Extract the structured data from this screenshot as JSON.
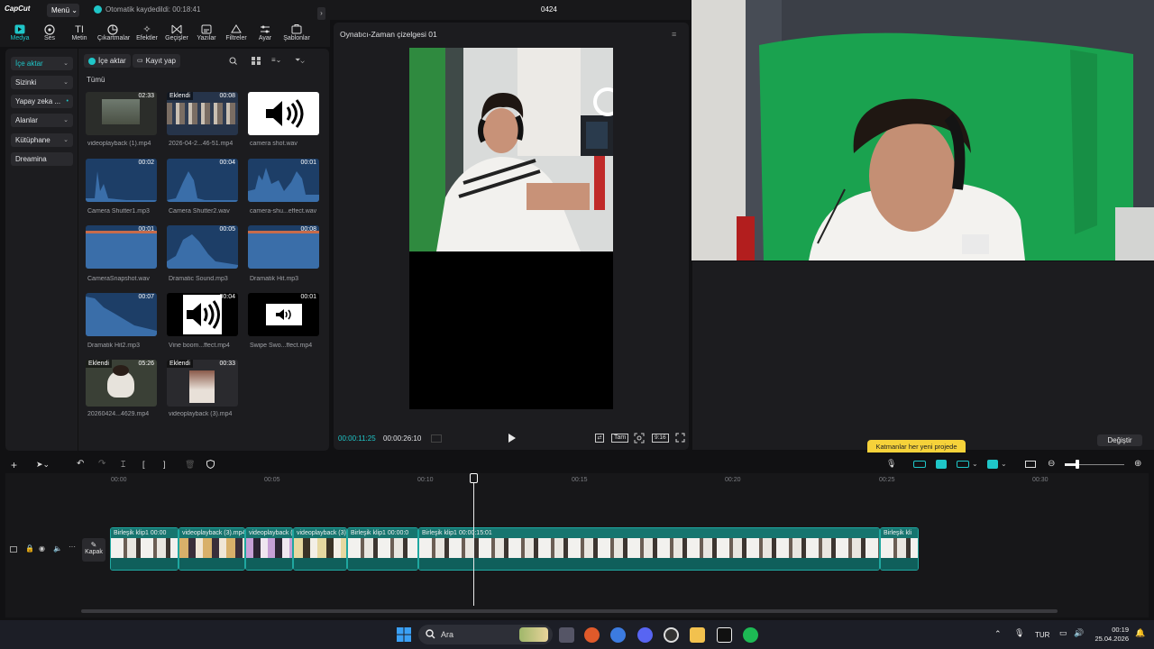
{
  "app": {
    "logo": "CapCut",
    "menu_label": "Menü",
    "save_status": "Otomatik kaydedildi: 00:18:41",
    "project_name": "0424"
  },
  "toolbar": {
    "tabs": [
      {
        "label": "Medya",
        "icon": "media-icon"
      },
      {
        "label": "Ses",
        "icon": "audio-icon"
      },
      {
        "label": "Metin",
        "icon": "text-icon"
      },
      {
        "label": "Çıkartmalar",
        "icon": "sticker-icon"
      },
      {
        "label": "Efektler",
        "icon": "effects-icon"
      },
      {
        "label": "Geçişler",
        "icon": "transitions-icon"
      },
      {
        "label": "Yazılar",
        "icon": "captions-icon"
      },
      {
        "label": "Filtreler",
        "icon": "filters-icon"
      },
      {
        "label": "Ayar",
        "icon": "adjust-icon"
      },
      {
        "label": "Şablonlar",
        "icon": "templates-icon"
      }
    ]
  },
  "sidebar": {
    "items": [
      {
        "label": "İçe aktar"
      },
      {
        "label": "Sizinki"
      },
      {
        "label": "Yapay zeka ..."
      },
      {
        "label": "Alanlar"
      },
      {
        "label": "Kütüphane"
      },
      {
        "label": "Dreamina"
      }
    ]
  },
  "media": {
    "import_label": "İçe aktar",
    "record_label": "Kayıt yap",
    "filter_all": "Tümü",
    "added_badge": "Eklendi",
    "items": [
      {
        "name": "videoplayback (1).mp4",
        "duration": "02:33"
      },
      {
        "name": "2026-04-2...46-51.mp4",
        "duration": "00:08"
      },
      {
        "name": "camera shot.wav",
        "duration": ""
      },
      {
        "name": "Camera Shutter1.mp3",
        "duration": "00:02"
      },
      {
        "name": "Camera Shutter2.wav",
        "duration": "00:04"
      },
      {
        "name": "camera-shu...effect.wav",
        "duration": "00:01"
      },
      {
        "name": "CameraSnapshot.wav",
        "duration": "00:01"
      },
      {
        "name": "Dramatic Sound.mp3",
        "duration": "00:05"
      },
      {
        "name": "Dramatik Hit.mp3",
        "duration": "00:08"
      },
      {
        "name": "Dramatik Hit2.mp3",
        "duration": "00:07"
      },
      {
        "name": "Vine boom...ffect.mp4",
        "duration": "00:04"
      },
      {
        "name": "Swipe Swo...ffect.mp4",
        "duration": "00:01"
      },
      {
        "name": "20260424...4629.mp4",
        "duration": "05:26"
      },
      {
        "name": "videoplayback (3).mp4",
        "duration": "00:33"
      }
    ]
  },
  "player": {
    "title": "Oynatıcı-Zaman çizelgesi 01",
    "current_time": "00:00:11:25",
    "total_time": "00:00:26:10",
    "full_label": "Tam",
    "ratio_label": "9:16"
  },
  "right": {
    "change_label": "Değiştir",
    "tooltip": "Katmanlar her yeni projede"
  },
  "timeline": {
    "ticks": [
      "00:00",
      "00:05",
      "00:10",
      "00:15",
      "00:20",
      "00:25",
      "00:30"
    ],
    "cover_label": "Kapak",
    "clips": [
      {
        "label": "Birleşik klip1  00:00"
      },
      {
        "label": "videoplayback (3).mp4"
      },
      {
        "label": "videoplayback ("
      },
      {
        "label": "videoplayback (3)"
      },
      {
        "label": "Birleşik klip1  00:00:0"
      },
      {
        "label": "Birleşik klip1  00:00:15:01"
      },
      {
        "label": "Birleşik kli"
      }
    ]
  },
  "taskbar": {
    "search_label": "Ara",
    "language": "TUR",
    "time": "00:19",
    "date": "25.04.2026"
  }
}
